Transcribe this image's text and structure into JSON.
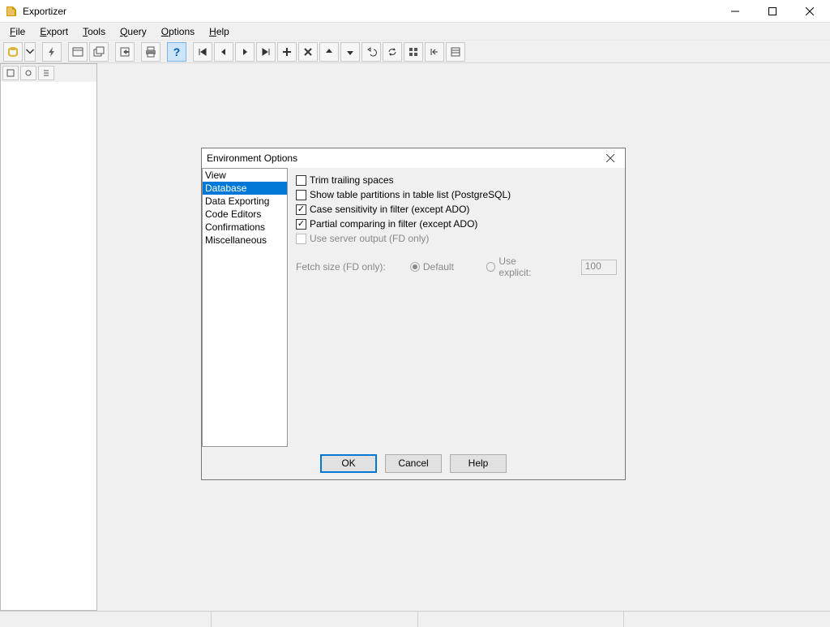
{
  "app": {
    "title": "Exportizer"
  },
  "menu": {
    "file": "File",
    "export": "Export",
    "tools": "Tools",
    "query": "Query",
    "options": "Options",
    "help": "Help"
  },
  "toolbar": {
    "items": [
      "open-db-icon",
      "dropdown-icon",
      "bolt-icon",
      "window-icon",
      "windows-icon",
      "export-icon",
      "print-icon",
      "help-icon",
      "first-icon",
      "prev-icon",
      "next-icon",
      "last-icon",
      "plus-icon",
      "delete-icon",
      "up-icon",
      "down-icon",
      "undo-icon",
      "refresh-icon",
      "grid-icon",
      "collapse-icon",
      "form-icon"
    ]
  },
  "dialog": {
    "title": "Environment Options",
    "sidebar": {
      "items": [
        {
          "label": "View"
        },
        {
          "label": "Database"
        },
        {
          "label": "Data Exporting"
        },
        {
          "label": "Code Editors"
        },
        {
          "label": "Confirmations"
        },
        {
          "label": "Miscellaneous"
        }
      ],
      "selected_index": 1
    },
    "options": {
      "trim_trailing": {
        "label": "Trim trailing spaces",
        "checked": false
      },
      "show_partitions": {
        "label": "Show table partitions in table list (PostgreSQL)",
        "checked": false
      },
      "case_sensitivity": {
        "label": "Case sensitivity in filter (except ADO)",
        "checked": true
      },
      "partial_compare": {
        "label": "Partial comparing in filter (except ADO)",
        "checked": true
      },
      "use_server_output": {
        "label": "Use server output (FD only)",
        "checked": false,
        "disabled": true
      }
    },
    "fetch": {
      "label": "Fetch size (FD only):",
      "default_label": "Default",
      "explicit_label": "Use explicit:",
      "value": "100"
    },
    "buttons": {
      "ok": "OK",
      "cancel": "Cancel",
      "help": "Help"
    }
  }
}
